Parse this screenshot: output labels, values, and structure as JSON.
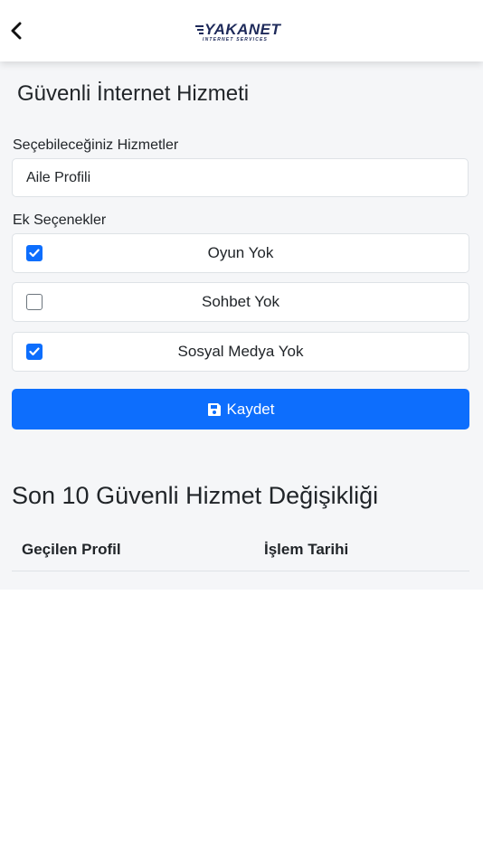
{
  "header": {
    "logo_text": "YAKANET",
    "logo_subtext": "INTERNET SERVICES"
  },
  "page": {
    "title": "Güvenli İnternet Hizmeti"
  },
  "services": {
    "label": "Seçebileceğiniz Hizmetler",
    "selected_value": "Aile Profili"
  },
  "extras": {
    "label": "Ek Seçenekler",
    "options": [
      {
        "label": "Oyun Yok",
        "checked": true
      },
      {
        "label": "Sohbet Yok",
        "checked": false
      },
      {
        "label": "Sosyal Medya Yok",
        "checked": true
      }
    ]
  },
  "actions": {
    "save_label": "Kaydet"
  },
  "history": {
    "title": "Son 10 Güvenli Hizmet Değişikliği",
    "columns": [
      "Geçilen Profil",
      "İşlem Tarihi"
    ]
  },
  "colors": {
    "primary": "#0d6efd",
    "background": "#f5f6f8",
    "brand": "#1e2a5a"
  }
}
